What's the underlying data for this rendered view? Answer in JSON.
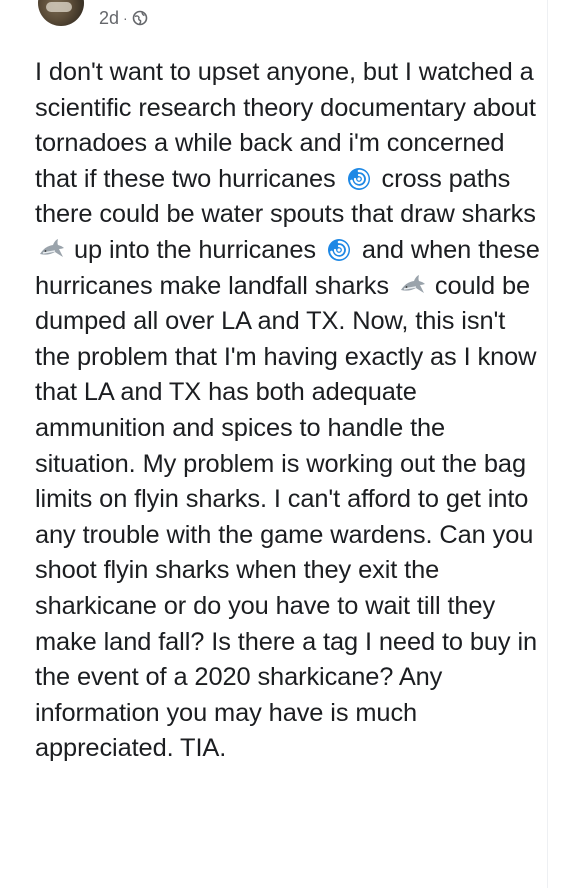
{
  "post": {
    "timestamp": "2d",
    "separator": "·",
    "privacy_icon": "globe-icon",
    "body": {
      "segments": [
        {
          "type": "text",
          "value": "I don't want to upset anyone, but I watched a scientific research theory documentary about tornadoes a while back and i'm concerned that if these two hurricanes "
        },
        {
          "type": "emoji",
          "name": "cyclone-emoji"
        },
        {
          "type": "text",
          "value": " cross paths there could be water spouts that draw sharks "
        },
        {
          "type": "emoji",
          "name": "shark-emoji"
        },
        {
          "type": "text",
          "value": " up into the hurricanes "
        },
        {
          "type": "emoji",
          "name": "cyclone-emoji"
        },
        {
          "type": "text",
          "value": " and when these hurricanes make landfall sharks "
        },
        {
          "type": "emoji",
          "name": "shark-emoji"
        },
        {
          "type": "text",
          "value": " could be dumped all over LA and TX. Now, this isn't the problem that I'm having exactly as I know that LA and TX has both adequate ammunition and spices to handle the situation. My problem is working out the bag limits on flyin sharks. I can't afford to get into any trouble with the game wardens. Can you shoot flyin sharks when they exit the sharkicane or do you have to wait till they make land fall? Is there a tag I need to buy in the event of a 2020 sharkicane? Any information you may have is much appreciated. TIA."
        }
      ]
    }
  },
  "colors": {
    "text": "#1c1e21",
    "meta_text": "#65676b",
    "cyclone": "#1e88e5",
    "shark": "#9aa3ab"
  }
}
